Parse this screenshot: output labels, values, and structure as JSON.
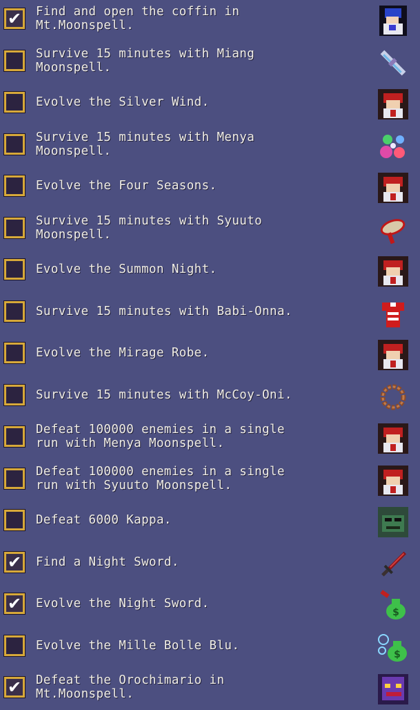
{
  "quests": [
    {
      "text": "Find and open the coffin in\nMt.Moonspell.",
      "checked": true,
      "icon": "miang-portrait-icon"
    },
    {
      "text": "Survive 15 minutes with Miang\nMoonspell.",
      "checked": false,
      "icon": "silver-wind-icon"
    },
    {
      "text": "Evolve the Silver Wind.",
      "checked": false,
      "icon": "character-portrait-icon"
    },
    {
      "text": "Survive 15 minutes with Menya\nMoonspell.",
      "checked": false,
      "icon": "four-seasons-icon"
    },
    {
      "text": "Evolve the Four Seasons.",
      "checked": false,
      "icon": "character-portrait-icon"
    },
    {
      "text": "Survive 15 minutes with Syuuto\nMoonspell.",
      "checked": false,
      "icon": "summon-night-icon"
    },
    {
      "text": "Evolve the Summon Night.",
      "checked": false,
      "icon": "character-portrait-icon"
    },
    {
      "text": "Survive 15 minutes with Babi-Onna.",
      "checked": false,
      "icon": "mirage-robe-icon"
    },
    {
      "text": "Evolve the Mirage Robe.",
      "checked": false,
      "icon": "character-portrait-icon"
    },
    {
      "text": "Survive 15 minutes with McCoy-Oni.",
      "checked": false,
      "icon": "prayer-beads-icon"
    },
    {
      "text": "Defeat 100000 enemies in a single\nrun with Menya Moonspell.",
      "checked": false,
      "icon": "character-portrait-icon"
    },
    {
      "text": "Defeat 100000 enemies in a single\nrun with Syuuto Moonspell.",
      "checked": false,
      "icon": "character-portrait-icon"
    },
    {
      "text": "Defeat 6000 Kappa.",
      "checked": false,
      "icon": "kappa-portrait-icon"
    },
    {
      "text": "Find a Night Sword.",
      "checked": true,
      "icon": "night-sword-icon"
    },
    {
      "text": "Evolve the Night Sword.",
      "checked": true,
      "icon": "money-bag-icon"
    },
    {
      "text": "Evolve the Mille Bolle Blu.",
      "checked": false,
      "icon": "money-bag-bubbles-icon"
    },
    {
      "text": "Defeat the Orochimario in\nMt.Moonspell.",
      "checked": true,
      "icon": "orochimario-portrait-icon"
    }
  ],
  "check_mark": "✔",
  "colors": {
    "background": "#4c4f80",
    "checkbox_border": "#d7a93a",
    "checkbox_fill": "#2c2340",
    "text": "#f1eee6"
  }
}
